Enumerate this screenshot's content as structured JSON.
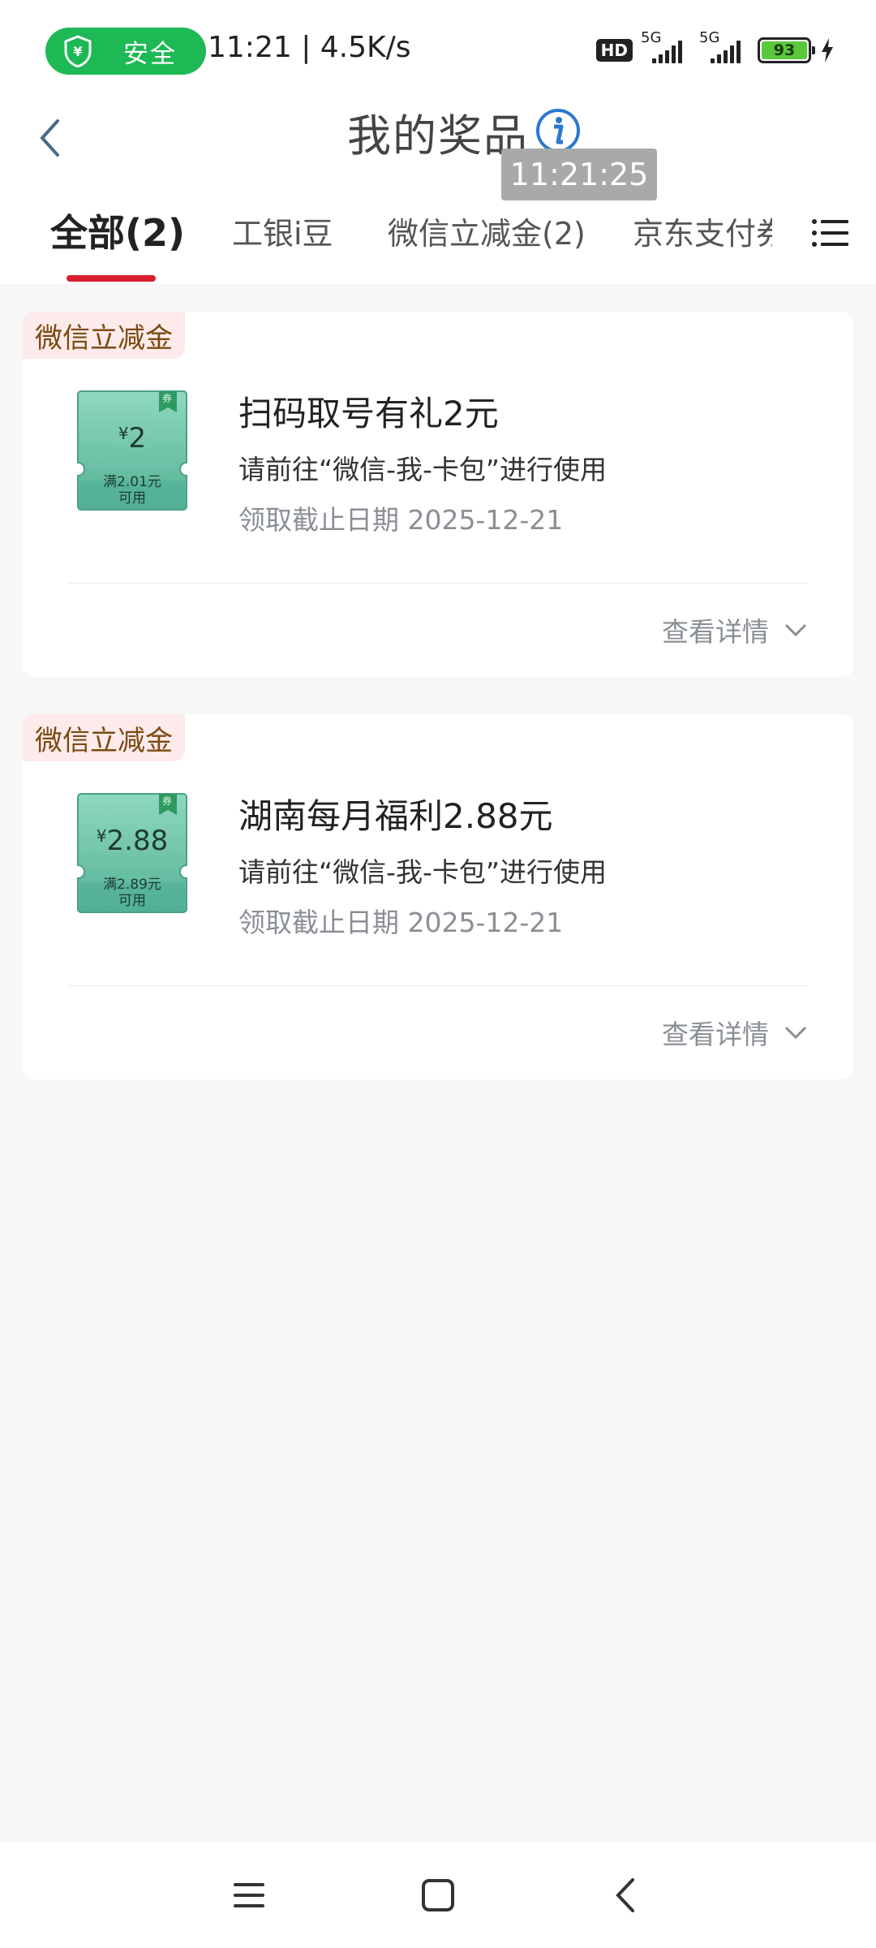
{
  "status_bar": {
    "safe_label": "安全",
    "time_speed": "11:21 | 4.5K/s",
    "hd_label": "HD",
    "signal1_label": "5G",
    "signal2_label": "5G",
    "battery": "93"
  },
  "header": {
    "title": "我的奖品",
    "timestamp": "11:21:25"
  },
  "tabs": [
    {
      "label": "全部(2)"
    },
    {
      "label": "工银i豆"
    },
    {
      "label": "微信立减金(2)"
    },
    {
      "label": "京东支付券"
    }
  ],
  "cards": [
    {
      "tag": "微信立减金",
      "coupon_yen": "¥",
      "coupon_amount": "2",
      "coupon_cond_line1": "满2.01元",
      "coupon_cond_line2": "可用",
      "coupon_mark": "券",
      "name": "扫码取号有礼2元",
      "instruction": "请前往“微信-我-卡包”进行使用",
      "date": "领取截止日期 2025-12-21",
      "detail_label": "查看详情"
    },
    {
      "tag": "微信立减金",
      "coupon_yen": "¥",
      "coupon_amount": "2.88",
      "coupon_cond_line1": "满2.89元",
      "coupon_cond_line2": "可用",
      "coupon_mark": "券",
      "name": "湖南每月福利2.88元",
      "instruction": "请前往“微信-我-卡包”进行使用",
      "date": "领取截止日期 2025-12-21",
      "detail_label": "查看详情"
    }
  ],
  "colors": {
    "accent": "#d81e2f",
    "safe_green": "#1db955",
    "coupon_teal": "#5fbfa4",
    "tag_bg": "#fdeaea",
    "tag_text": "#7a4a10"
  }
}
